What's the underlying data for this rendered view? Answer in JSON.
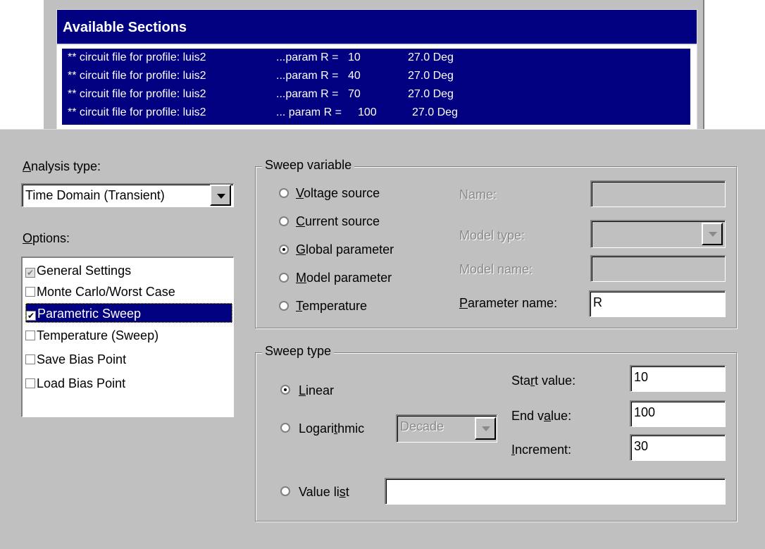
{
  "sections": {
    "title": "Available Sections",
    "rows": [
      {
        "name": "** circuit file for profile: luis2",
        "param": "...param R =",
        "value": "10",
        "temp": "27.0 Deg"
      },
      {
        "name": "** circuit file for profile: luis2",
        "param": "...param R =",
        "value": "40",
        "temp": "27.0 Deg"
      },
      {
        "name": "** circuit file for profile: luis2",
        "param": "...param R =",
        "value": "70",
        "temp": "27.0 Deg"
      },
      {
        "name": "** circuit file for profile: luis2",
        "param": "... param R =",
        "value": "100",
        "temp": "27.0 Deg"
      }
    ]
  },
  "analysis": {
    "label": "Analysis type:",
    "value": "Time Domain (Transient)"
  },
  "options": {
    "label": "Options:",
    "items": [
      {
        "label": "General Settings",
        "checked": true,
        "greyed": true
      },
      {
        "label": "Monte Carlo/Worst Case",
        "checked": false
      },
      {
        "label": "Parametric Sweep",
        "checked": true,
        "selected": true
      },
      {
        "label": "Temperature (Sweep)",
        "checked": false
      },
      {
        "label": "Save Bias Point",
        "checked": false
      },
      {
        "label": "Load Bias Point",
        "checked": false
      }
    ]
  },
  "sweep_variable": {
    "title": "Sweep variable",
    "radios": [
      {
        "label": "Voltage source",
        "selected": false
      },
      {
        "label": "Current source",
        "selected": false
      },
      {
        "label": "Global parameter",
        "selected": true
      },
      {
        "label": "Model parameter",
        "selected": false
      },
      {
        "label": "Temperature",
        "selected": false
      }
    ],
    "name_label": "Name:",
    "model_type_label": "Model type:",
    "model_name_label": "Model name:",
    "parameter_name_label": "Parameter name:",
    "parameter_name_value": "R"
  },
  "sweep_type": {
    "title": "Sweep type",
    "linear_label": "Linear",
    "log_label": "Logarithmic",
    "log_option": "Decade",
    "start_label": "Start value:",
    "start_value": "10",
    "end_label": "End value:",
    "end_value": "100",
    "increment_label": "Increment:",
    "increment_value": "30",
    "value_list_label": "Value list",
    "value_list_value": ""
  }
}
